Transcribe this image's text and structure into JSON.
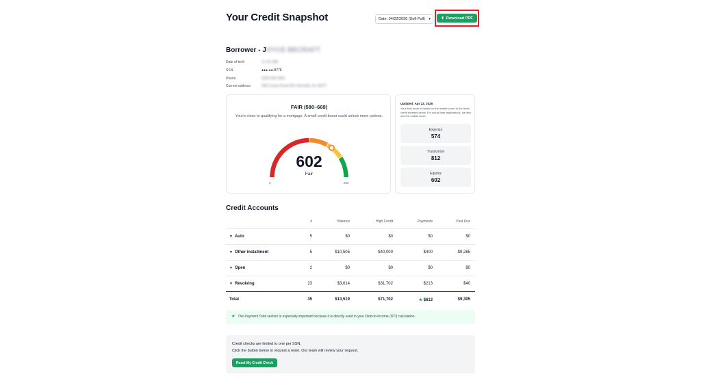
{
  "header": {
    "title": "Your Credit Snapshot",
    "date_select": "Date: 04/22/2026 (Soft Pull)",
    "download_label": "Download PDF"
  },
  "borrower": {
    "title_prefix": "Borrower - J",
    "title_redacted": "OYCE BECRAFT",
    "fields": [
      {
        "label": "Date of birth",
        "value": "11-24-1981"
      },
      {
        "label": "SSN",
        "value": "●●●-●●-8776"
      },
      {
        "label": "Phone",
        "value": "(420) 936-0420"
      },
      {
        "label": "Current address",
        "value": "638 County Road 503, Moreville, AL 35077"
      }
    ]
  },
  "score": {
    "range": "FAIR (580–669)",
    "description": "You're close to qualifying for a mortgage. A small credit boost could unlock more options.",
    "value": "602",
    "word": "Fair",
    "scale_min": "0",
    "scale_max": "850",
    "fraction": 0.7082
  },
  "bureaus": {
    "updated": "Updated: Apr 22, 2026",
    "note": "Your final score is based on the middle score of the three credit bureaus below. For actual loan applications, we also use the middle score.",
    "items": [
      {
        "name": "Experian",
        "score": "574"
      },
      {
        "name": "TransUnion",
        "score": "812"
      },
      {
        "name": "Equifax",
        "score": "602"
      }
    ]
  },
  "accounts": {
    "title": "Credit Accounts",
    "columns": [
      "#",
      "Balance",
      "High Credit",
      "Payments",
      "Past Due"
    ],
    "rows": [
      {
        "name": "Auto",
        "count": "5",
        "balance": "$0",
        "high_credit": "$0",
        "payments": "$0",
        "past_due": "$0"
      },
      {
        "name": "Other installment",
        "count": "5",
        "balance": "$10,505",
        "high_credit": "$40,000",
        "payments": "$400",
        "past_due": "$9,265"
      },
      {
        "name": "Open",
        "count": "2",
        "balance": "$0",
        "high_credit": "$0",
        "payments": "$0",
        "past_due": "$0"
      },
      {
        "name": "Revolving",
        "count": "23",
        "balance": "$3,014",
        "high_credit": "$31,702",
        "payments": "$213",
        "past_due": "$40"
      }
    ],
    "total": {
      "name": "Total",
      "count": "35",
      "balance": "$13,519",
      "high_credit": "$71,702",
      "payments": "$613",
      "past_due": "$9,305"
    }
  },
  "dti_note": "The Payment Total section is especially important because it is directly used in your Debt-to-Income (DTI) calculation.",
  "reset": {
    "line1": "Credit checks are limited to one per SSN.",
    "line2": "Click the button below to request a reset. Our team will review your request.",
    "button_label": "Reset My Credit Check"
  },
  "colors": {
    "brand_green": "#1f9d63",
    "highlight_red": "#e11d2e",
    "gauge_red": "#d62828",
    "gauge_orange": "#f08c2a",
    "gauge_yellow": "#f5c542",
    "gauge_green": "#16a34a"
  },
  "icons": {
    "download": "download-icon",
    "caret": "chevron-down-icon",
    "row_toggle": "triangle-down-icon",
    "star": "star-icon"
  }
}
